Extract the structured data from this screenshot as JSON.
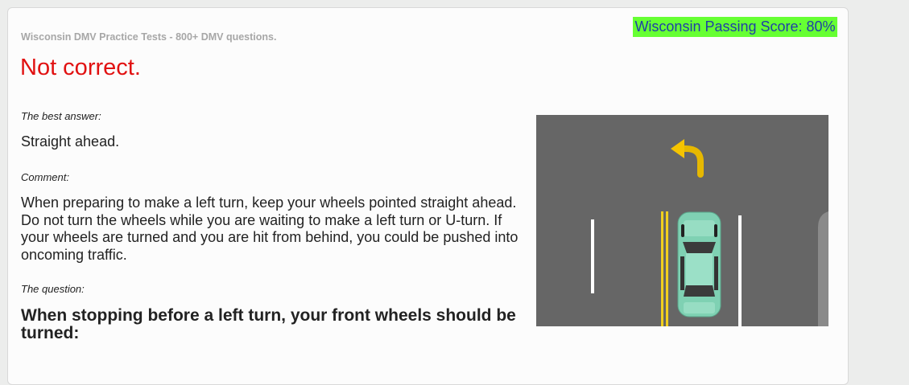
{
  "header": {
    "site_title": "Wisconsin DMV Practice Tests - 800+ DMV questions.",
    "passing_score": "Wisconsin Passing Score: 80%"
  },
  "result": {
    "title": "Not correct."
  },
  "answer": {
    "label": "The best answer:",
    "text": "Straight ahead."
  },
  "comment": {
    "label": "Comment:",
    "text": "When preparing to make a left turn, keep your wheels pointed straight ahead. Do not turn the wheels while you are waiting to make a left turn or U-turn. If your wheels are turned and you are hit from behind, you could be pushed into oncoming traffic."
  },
  "question": {
    "label": "The question:",
    "text": "When stopping before a left turn, your front wheels should be turned:"
  },
  "colors": {
    "score_badge_bg": "#66ff33",
    "score_badge_text": "#1f3fa6",
    "incorrect_red": "#e11111",
    "road_gray": "#666666",
    "car_teal": "#7fd1b3"
  }
}
